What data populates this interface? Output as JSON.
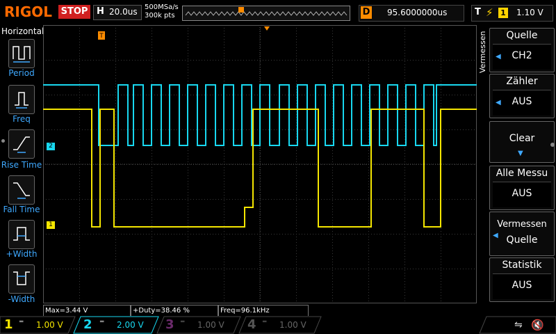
{
  "brand": "RIGOL",
  "status": "STOP",
  "timebase": {
    "label": "H",
    "value": "20.0us"
  },
  "sample": {
    "rate": "500MSa/s",
    "points": "300k pts"
  },
  "delay": {
    "label": "D",
    "value": "95.6000000us"
  },
  "trigger": {
    "label": "T",
    "edge_icon": "rising-edge-icon",
    "source": "1",
    "level": "1.10 V"
  },
  "left_menu": {
    "title": "Horizontal",
    "items": [
      {
        "label": "Period",
        "icon": "period-icon"
      },
      {
        "label": "Freq",
        "icon": "freq-icon"
      },
      {
        "label": "Rise Time",
        "icon": "rise-time-icon"
      },
      {
        "label": "Fall Time",
        "icon": "fall-time-icon"
      },
      {
        "label": "+Width",
        "icon": "pos-width-icon"
      },
      {
        "label": "-Width",
        "icon": "neg-width-icon"
      }
    ]
  },
  "right_menu": {
    "tab": "Vermessen",
    "items": [
      {
        "header": "Quelle",
        "value": "CH2"
      },
      {
        "header": "Zähler",
        "value": "AUS"
      },
      {
        "header": "Clear",
        "value": ""
      },
      {
        "header": "Alle Messu",
        "value": "AUS"
      },
      {
        "header": "Vermessen",
        "value": "Quelle"
      },
      {
        "header": "Statistik",
        "value": "AUS"
      }
    ]
  },
  "measurements": [
    "Max=3.44 V",
    "+Duty=38.46 %",
    "Freq=96.1kHz"
  ],
  "channels": [
    {
      "num": "1",
      "coupling": "DC",
      "scale": "1.00 V",
      "color": "#f5e600"
    },
    {
      "num": "2",
      "coupling": "DC",
      "scale": "2.00 V",
      "color": "#18d8f0"
    },
    {
      "num": "3",
      "coupling": "DC",
      "scale": "1.00 V",
      "color": "#c040c0"
    },
    {
      "num": "4",
      "coupling": "DC",
      "scale": "1.00 V",
      "color": "#3060ff"
    }
  ],
  "markers": {
    "ch1": "1",
    "ch2": "2",
    "trig": "T"
  },
  "colors": {
    "ch1": "#f5e600",
    "ch2": "#18d8f0",
    "accent": "#ff8c00",
    "menu_label": "#3fa9ff"
  }
}
